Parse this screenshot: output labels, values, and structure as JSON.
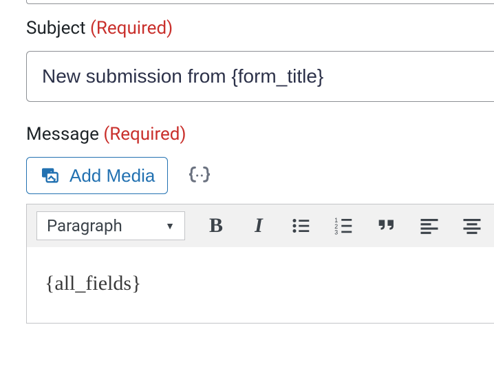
{
  "labels": {
    "subject": "Subject",
    "message": "Message",
    "required": "(Required)"
  },
  "subject": {
    "value": "New submission from {form_title}"
  },
  "buttons": {
    "add_media": "Add Media"
  },
  "toolbar": {
    "format_selected": "Paragraph"
  },
  "editor": {
    "content": "{all_fields}"
  },
  "icons": {
    "media": "media-icon",
    "merge": "merge-tag-icon",
    "bold": "bold-icon",
    "italic": "italic-icon",
    "ul": "bullet-list-icon",
    "ol": "numbered-list-icon",
    "quote": "blockquote-icon",
    "align_left": "align-left-icon",
    "align_center": "align-center-icon"
  }
}
